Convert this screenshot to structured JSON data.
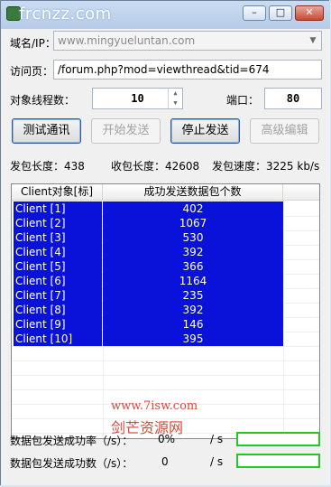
{
  "window": {
    "title": "frcnzz.com",
    "minimize": "–",
    "maximize": "□",
    "close": "✕"
  },
  "form": {
    "domain_label": "域名/IP：",
    "domain_value": "www.mingyueluntan.com",
    "page_label": "访问页：",
    "page_value": "/forum.php?mod=viewthread&tid=674",
    "threads_label": "对象线程数：",
    "threads_value": "10",
    "port_label": "端口：",
    "port_value": "80"
  },
  "buttons": {
    "test": "测试通讯",
    "start": "开始发送",
    "stop": "停止发送",
    "advanced": "高级编辑"
  },
  "stats": {
    "send_len_label": "发包长度：",
    "send_len_value": "438",
    "recv_len_label": "收包长度：",
    "recv_len_value": "42608",
    "speed_label": "发包速度：",
    "speed_value": "3225 kb/s"
  },
  "table": {
    "headers": [
      "Client对象[标]",
      "成功发送数据包个数"
    ],
    "rows": [
      [
        "Client [1]",
        "402"
      ],
      [
        "Client [2]",
        "1067"
      ],
      [
        "Client [3]",
        "530"
      ],
      [
        "Client [4]",
        "392"
      ],
      [
        "Client [5]",
        "366"
      ],
      [
        "Client [6]",
        "1164"
      ],
      [
        "Client [7]",
        "235"
      ],
      [
        "Client [8]",
        "392"
      ],
      [
        "Client [9]",
        "146"
      ],
      [
        "Client [10]",
        "395"
      ]
    ],
    "selection_color": "#0a12d9"
  },
  "watermark": {
    "line1": "www.7isw.com",
    "line2": "剑芒资源网"
  },
  "footer": {
    "rate_label": "数据包发送成功率（/s）：",
    "rate_value": "0%",
    "rate_unit": "/ s",
    "rate_progress": 0,
    "count_label": "数据包发送成功数（/s）：",
    "count_value": "0",
    "count_unit": "/ s",
    "count_progress": 0,
    "progress_color": "#23c823"
  }
}
